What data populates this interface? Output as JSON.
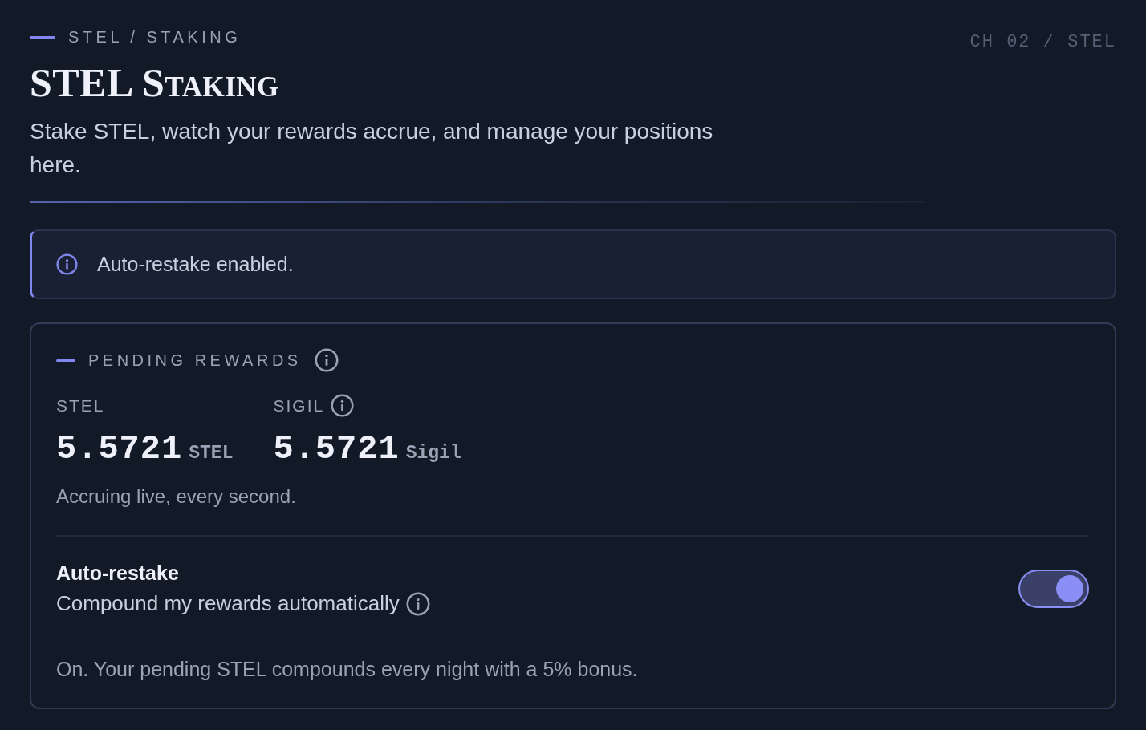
{
  "header": {
    "breadcrumb": "STEL / STAKING",
    "chapter": "CH 02 / STEL",
    "title": "STEL Staking",
    "description": "Stake STEL, watch your rewards accrue, and manage your positions here."
  },
  "alert": {
    "message": "Auto-restake enabled."
  },
  "rewards_card": {
    "heading": "PENDING REWARDS",
    "balances": [
      {
        "label": "STEL",
        "has_info": false,
        "amount": "5.5721",
        "unit": "STEL"
      },
      {
        "label": "SIGIL",
        "has_info": true,
        "amount": "5.5721",
        "unit": "Sigil"
      }
    ],
    "note": "Accruing live, every second.",
    "setting": {
      "title": "Auto-restake",
      "description": "Compound my rewards automatically",
      "on": true
    },
    "status": "On. Your pending STEL compounds every night with a 5% bonus."
  }
}
